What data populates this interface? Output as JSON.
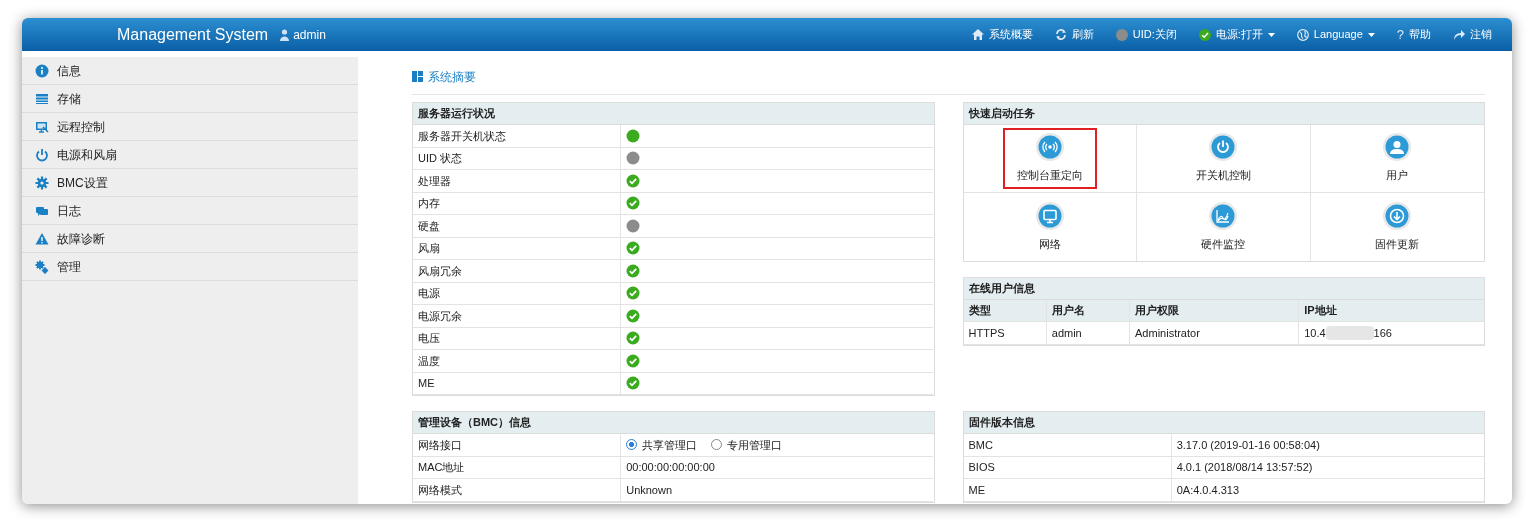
{
  "header": {
    "title": "Management System",
    "user": "admin",
    "nav": [
      {
        "kind": "home",
        "label": "系统概要"
      },
      {
        "kind": "refresh",
        "label": "刷新"
      },
      {
        "kind": "dot-off",
        "label": "UID:关闭"
      },
      {
        "kind": "check",
        "label": "电源:打开",
        "dropdown": true
      },
      {
        "kind": "globe",
        "label": "Language",
        "dropdown": true
      },
      {
        "kind": "glyph",
        "glyph": "?",
        "label": "帮助"
      },
      {
        "kind": "share",
        "label": "注销"
      }
    ]
  },
  "sidebar": {
    "items": [
      {
        "kind": "info",
        "label": "信息"
      },
      {
        "kind": "storage",
        "label": "存储"
      },
      {
        "kind": "monitor",
        "label": "远程控制"
      },
      {
        "kind": "power",
        "label": "电源和风扇"
      },
      {
        "kind": "gear",
        "label": "BMC设置"
      },
      {
        "kind": "chat",
        "label": "日志"
      },
      {
        "kind": "warning",
        "label": "故障诊断"
      },
      {
        "kind": "gears",
        "label": "管理"
      }
    ]
  },
  "page_title": "系统摘要",
  "server_status": {
    "title": "服务器运行状况",
    "rows": [
      {
        "label": "服务器开关机状态",
        "kind": "on"
      },
      {
        "label": "UID 状态",
        "kind": "off"
      },
      {
        "label": "处理器",
        "kind": "ok"
      },
      {
        "label": "内存",
        "kind": "ok"
      },
      {
        "label": "硬盘",
        "kind": "off"
      },
      {
        "label": "风扇",
        "kind": "ok"
      },
      {
        "label": "风扇冗余",
        "kind": "ok"
      },
      {
        "label": "电源",
        "kind": "ok"
      },
      {
        "label": "电源冗余",
        "kind": "ok"
      },
      {
        "label": "电压",
        "kind": "ok"
      },
      {
        "label": "温度",
        "kind": "ok"
      },
      {
        "label": "ME",
        "kind": "ok"
      }
    ]
  },
  "quick_tasks": {
    "title": "快速启动任务",
    "items": [
      {
        "kind": "broadcast",
        "label": "控制台重定向",
        "highlighted": true
      },
      {
        "kind": "power",
        "label": "开关机控制",
        "highlighted": false
      },
      {
        "kind": "user",
        "label": "用户",
        "highlighted": false
      },
      {
        "kind": "monitor",
        "label": "网络",
        "highlighted": false
      },
      {
        "kind": "chart",
        "label": "硬件监控",
        "highlighted": false
      },
      {
        "kind": "download",
        "label": "固件更新",
        "highlighted": false
      }
    ]
  },
  "online_users": {
    "title": "在线用户信息",
    "columns": [
      "类型",
      "用户名",
      "用户权限",
      "IP地址"
    ],
    "rows": [
      {
        "type": "HTTPS",
        "user": "admin",
        "role": "Administrator",
        "ip_start": "10.4",
        "ip_end": "166",
        "ip_redacted": true
      }
    ]
  },
  "bmc_info": {
    "title": "管理设备（BMC）信息",
    "rows": [
      {
        "kind": "radio",
        "label": "网络接口",
        "options": [
          {
            "label": "共享管理口",
            "selected": true
          },
          {
            "label": "专用管理口",
            "selected": false
          }
        ]
      },
      {
        "kind": "text",
        "label": "MAC地址",
        "value": "00:00:00:00:00:00"
      },
      {
        "kind": "text",
        "label": "网络模式",
        "value": "Unknown"
      }
    ]
  },
  "firmware": {
    "title": "固件版本信息",
    "rows": [
      {
        "label": "BMC",
        "value": "3.17.0 (2019-01-16 00:58:04)"
      },
      {
        "label": "BIOS",
        "value": "4.0.1 (2018/08/14 13:57:52)"
      },
      {
        "label": "ME",
        "value": "0A:4.0.4.313"
      }
    ]
  }
}
